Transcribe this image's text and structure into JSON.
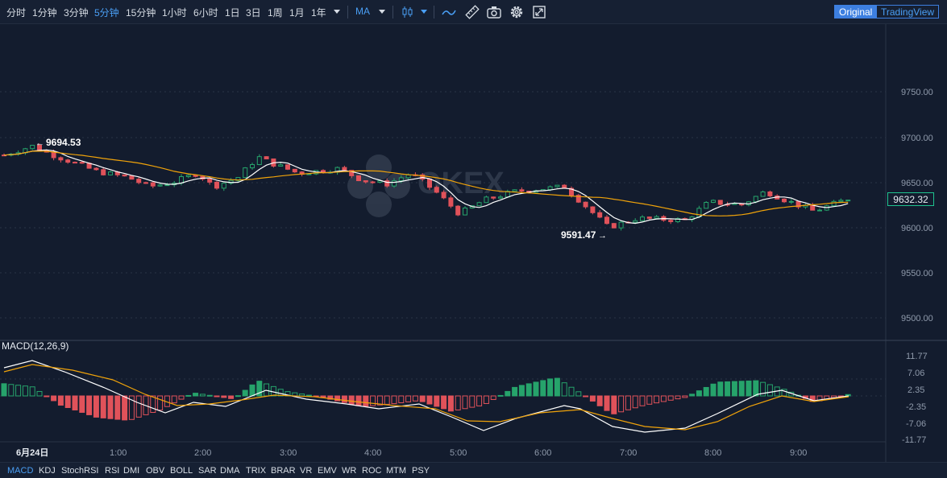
{
  "toolbar": {
    "timeframes": [
      "分时",
      "1分钟",
      "3分钟",
      "5分钟",
      "15分钟",
      "1小时",
      "6小时",
      "1日",
      "3日",
      "1周",
      "1月",
      "1年"
    ],
    "active_timeframe": "5分钟",
    "indicator": "MA",
    "modes": [
      "Original",
      "TradingView"
    ],
    "active_mode": "Original"
  },
  "chart": {
    "watermark": "OKEX",
    "high_label": "9694.53",
    "low_label": "9591.47",
    "current_price": "9632.32",
    "price_axis": [
      "9750.00",
      "9700.00",
      "9650.00",
      "9600.00",
      "9550.00",
      "9500.00"
    ],
    "macd_title": "MACD(12,26,9)",
    "macd_axis": [
      "11.77",
      "7.06",
      "2.35",
      "-2.35",
      "-7.06",
      "-11.77"
    ],
    "time_axis": [
      "6月24日",
      "1:00",
      "2:00",
      "3:00",
      "4:00",
      "5:00",
      "6:00",
      "7:00",
      "8:00",
      "9:00"
    ],
    "colors": {
      "up": "#26a36b",
      "down": "#e0525a",
      "ma_fast": "#ffffff",
      "ma_slow": "#f0a30a",
      "background": "#131c2e",
      "accent": "#3d7fe0"
    }
  },
  "indicators_bar": [
    "MACD",
    "KDJ",
    "StochRSI",
    "RSI",
    "DMI",
    "OBV",
    "BOLL",
    "SAR",
    "DMA",
    "TRIX",
    "BRAR",
    "VR",
    "EMV",
    "WR",
    "ROC",
    "MTM",
    "PSY"
  ],
  "active_indicator": "MACD"
}
